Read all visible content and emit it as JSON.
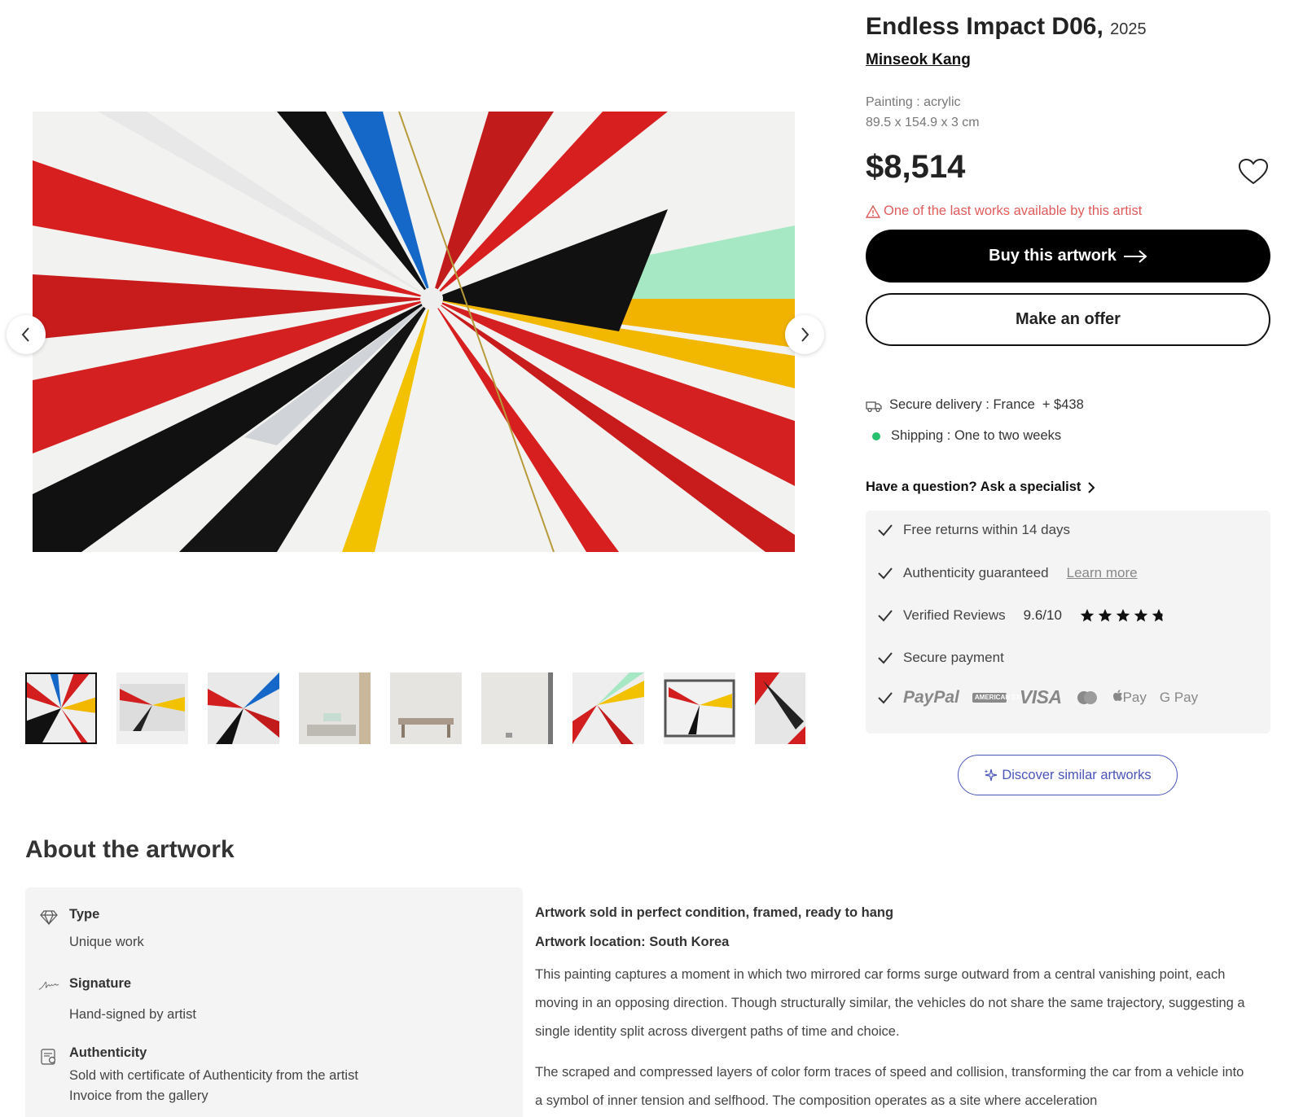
{
  "gallery": {
    "prev_label": "Previous image",
    "next_label": "Next image",
    "thumbnails": [
      "artwork-front",
      "artwork-angle-1",
      "artwork-angle-2",
      "room-view-1",
      "room-view-2",
      "room-view-3",
      "artwork-detail-1",
      "artwork-framed",
      "artwork-detail-2"
    ]
  },
  "artwork": {
    "title": "Endless Impact D06,",
    "year": "2025",
    "artist": "Minseok Kang",
    "medium": "Painting : acrylic",
    "dimensions": "89.5 x 154.9 x 3 cm",
    "price": "$8,514",
    "alert": "One of the last works available by this artist"
  },
  "actions": {
    "buy_label": "Buy this artwork",
    "offer_label": "Make an offer",
    "discover_label": "Discover similar artworks"
  },
  "delivery": {
    "delivery_text": "Secure delivery : France",
    "delivery_cost": "+ $438",
    "shipping_text": "Shipping : One to two weeks"
  },
  "question": {
    "label": "Have a question? Ask a specialist"
  },
  "assurance": {
    "returns": "Free returns within 14 days",
    "authenticity": "Authenticity guaranteed",
    "learn_more": "Learn more",
    "reviews": "Verified Reviews",
    "score": "9.6/10",
    "stars_rating": 4.8,
    "payment": "Secure payment",
    "payment_methods": [
      "PayPal",
      "AMERICAN EXPRESS",
      "VISA",
      "MasterCard",
      "Pay",
      "G Pay"
    ]
  },
  "about": {
    "title": "About the artwork",
    "type_label": "Type",
    "type_value": "Unique work",
    "signature_label": "Signature",
    "signature_value": "Hand-signed by artist",
    "auth_label": "Authenticity",
    "auth_value_1": "Sold with certificate of Authenticity from the artist",
    "auth_value_2": "Invoice from the gallery",
    "condition": "Artwork sold in perfect condition, framed, ready to hang",
    "location": "Artwork location: South Korea",
    "paragraph_1": "This painting captures a moment in which two mirrored car forms surge outward from a central vanishing point, each moving in an opposing direction. Though structurally similar, the vehicles do not share the same trajectory, suggesting a single identity split across divergent paths of time and choice.",
    "paragraph_2": "The scraped and compressed layers of color form traces of speed and collision, transforming the car from a vehicle into a symbol of inner tension and selfhood. The composition operates as a site where acceleration"
  },
  "colors": {
    "alert": "#e05b5b",
    "discover": "#4a55b8",
    "shipping_dot": "#27c06f",
    "panel_bg": "#f4f4f4"
  }
}
